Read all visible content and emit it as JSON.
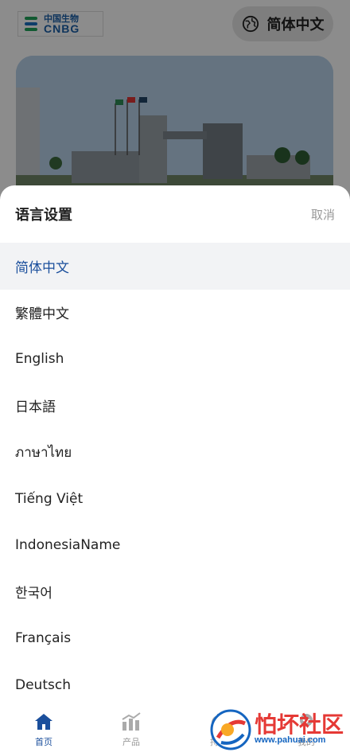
{
  "header": {
    "logo": {
      "cn": "中国生物",
      "en": "CNBG"
    },
    "language_button": {
      "icon": "globe-icon",
      "label": "简体中文"
    }
  },
  "sheet": {
    "title": "语言设置",
    "cancel_label": "取消",
    "selected_index": 0,
    "options": [
      {
        "label": "简体中文"
      },
      {
        "label": "繁體中文"
      },
      {
        "label": "English"
      },
      {
        "label": "日本語"
      },
      {
        "label": "ภาษาไทย"
      },
      {
        "label": "Tiếng Việt"
      },
      {
        "label": "IndonesiaName"
      },
      {
        "label": "한국어"
      },
      {
        "label": "Français"
      },
      {
        "label": "Deutsch"
      }
    ]
  },
  "tabbar": {
    "tabs": [
      {
        "label": "首页",
        "icon": "home-icon",
        "active": true
      },
      {
        "label": "产品",
        "icon": "chart-icon",
        "active": false
      },
      {
        "label": "持仓",
        "icon": "holdings-icon",
        "active": false
      },
      {
        "label": "我的",
        "icon": "profile-icon",
        "active": false
      }
    ]
  },
  "watermark": {
    "main": "怕坏社区",
    "url": "www.pahuai.com"
  },
  "colors": {
    "accent": "#1b4f9c",
    "selected_bg": "#f2f3f5",
    "muted": "#999999"
  }
}
